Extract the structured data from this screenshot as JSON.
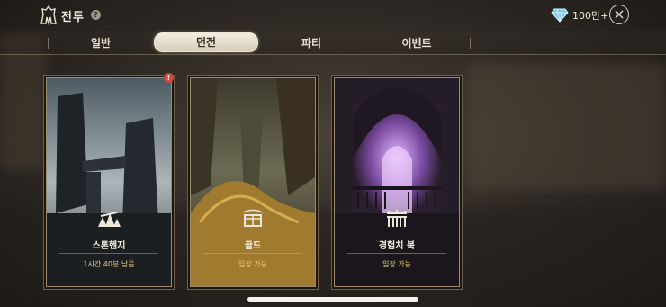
{
  "header": {
    "title": "전투",
    "help_icon": "?",
    "currency_value": "100만+",
    "close_icon": "×"
  },
  "tabs": [
    {
      "label": "일반",
      "active": false
    },
    {
      "label": "던전",
      "active": true
    },
    {
      "label": "파티",
      "active": false
    },
    {
      "label": "이벤트",
      "active": false
    }
  ],
  "cards": [
    {
      "name": "스톤헨지",
      "status": "1시간 40분 남음",
      "icon": "stonehenge-icon",
      "alert": "!"
    },
    {
      "name": "골드",
      "status": "입장 가능",
      "icon": "gold-chest-icon"
    },
    {
      "name": "경험치 북",
      "status": "입장 가능",
      "icon": "gate-icon"
    }
  ]
}
